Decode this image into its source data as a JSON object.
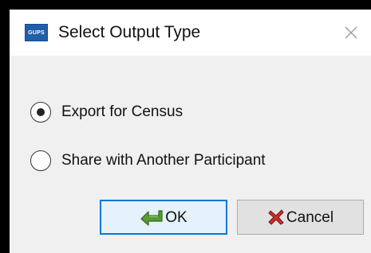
{
  "dialog": {
    "title": "Select Output Type",
    "app_icon_text": "GUPS",
    "close_icon": "close-icon"
  },
  "options": [
    {
      "label": "Export for Census",
      "selected": true
    },
    {
      "label": "Share with Another Participant",
      "selected": false
    }
  ],
  "buttons": {
    "ok_label": "OK",
    "ok_icon": "green-arrow-icon",
    "cancel_label": "Cancel",
    "cancel_icon": "red-x-icon"
  },
  "colors": {
    "accent": "#0078d7",
    "app_icon_bg": "#1f5fa8",
    "ok_icon": "#4a8a2a",
    "cancel_icon": "#c0281e"
  }
}
